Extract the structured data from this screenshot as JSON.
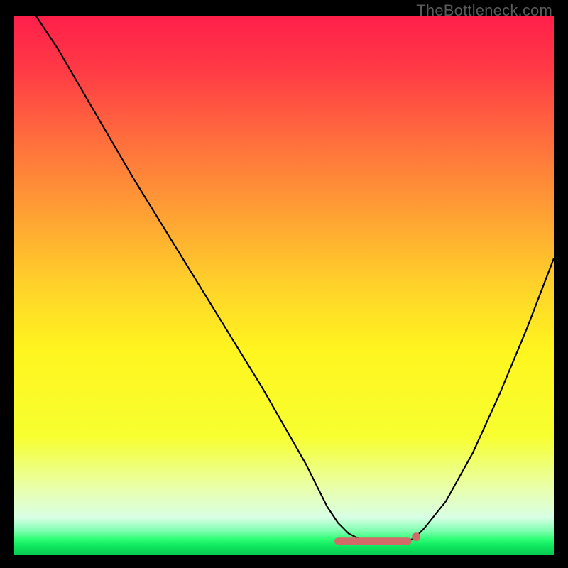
{
  "watermark": "TheBottleneck.com",
  "gradient": {
    "stops": [
      {
        "offset": 0.0,
        "color": "#ff1f4a"
      },
      {
        "offset": 0.1,
        "color": "#ff3a46"
      },
      {
        "offset": 0.22,
        "color": "#ff6a3e"
      },
      {
        "offset": 0.35,
        "color": "#ff9a35"
      },
      {
        "offset": 0.5,
        "color": "#ffd22a"
      },
      {
        "offset": 0.62,
        "color": "#fff51f"
      },
      {
        "offset": 0.78,
        "color": "#f7ff30"
      },
      {
        "offset": 0.88,
        "color": "#e8ffb0"
      },
      {
        "offset": 0.93,
        "color": "#d8ffe5"
      },
      {
        "offset": 0.955,
        "color": "#7fffb0"
      },
      {
        "offset": 0.97,
        "color": "#2eff75"
      },
      {
        "offset": 0.982,
        "color": "#10e860"
      },
      {
        "offset": 1.0,
        "color": "#06c94f"
      }
    ]
  },
  "chart_data": {
    "type": "line",
    "title": "",
    "xlabel": "",
    "ylabel": "",
    "xlim": [
      0,
      100
    ],
    "ylim": [
      0,
      100
    ],
    "series": [
      {
        "name": "curve",
        "x": [
          4,
          8,
          15,
          22,
          30,
          38,
          46,
          54,
          58,
          60,
          62,
          64,
          66,
          68,
          70,
          72,
          73,
          74,
          76,
          80,
          85,
          90,
          95,
          100
        ],
        "values": [
          100,
          94,
          82,
          70,
          57,
          44,
          31,
          17,
          9,
          6,
          4,
          3,
          2.5,
          2.5,
          2.5,
          2.6,
          2.8,
          3,
          5,
          10,
          19,
          30,
          42,
          55
        ]
      }
    ],
    "markers": [
      {
        "name": "flat-region",
        "x_from": 60,
        "x_to": 73,
        "y": 2.6
      },
      {
        "name": "dot-right",
        "x": 74.5,
        "y": 3.4
      }
    ]
  }
}
